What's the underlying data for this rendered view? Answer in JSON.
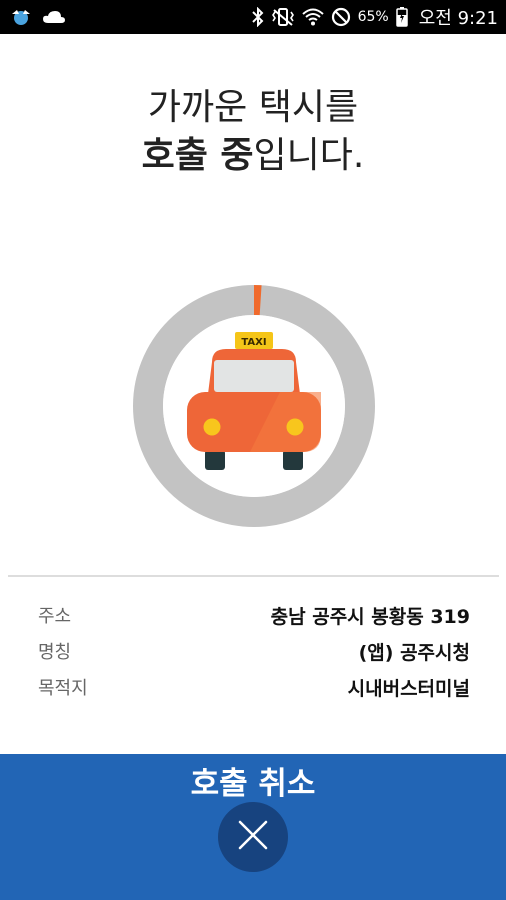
{
  "status_bar": {
    "battery_percent": "65%",
    "time": "오전 9:21",
    "icons": [
      "app-notification-icon",
      "cloud-icon",
      "bluetooth-icon",
      "vibrate-icon",
      "wifi-icon",
      "do-not-disturb-icon",
      "battery-charging-icon"
    ]
  },
  "heading": {
    "line1": "가까운 택시를",
    "line2_bold": "호출 중",
    "line2_rest": "입니다."
  },
  "graphic": {
    "sign_text": "TAXI",
    "colors": {
      "ring": "#c3c3c3",
      "progress": "#f06a2c",
      "taxi_body": "#ee6638",
      "sign": "#f5c518"
    },
    "progress": 0.01
  },
  "info": {
    "rows": [
      {
        "label": "주소",
        "value": "충남 공주시 봉황동 319"
      },
      {
        "label": "명칭",
        "value": "(앱) 공주시청"
      },
      {
        "label": "목적지",
        "value": "시내버스터미널"
      }
    ]
  },
  "cancel": {
    "title": "호출 취소",
    "colors": {
      "panel": "#2265b5",
      "button": "#17437f"
    }
  }
}
